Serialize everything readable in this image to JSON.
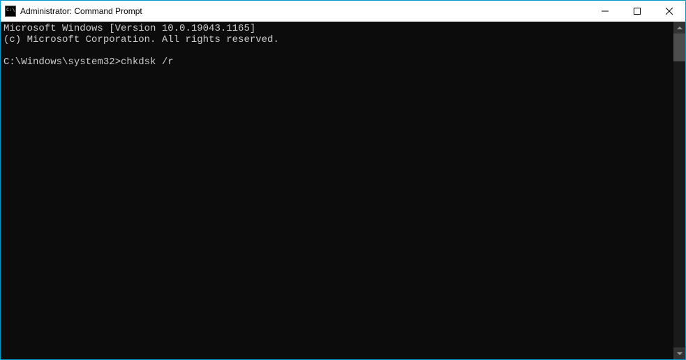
{
  "window": {
    "title": "Administrator: Command Prompt"
  },
  "terminal": {
    "line1": "Microsoft Windows [Version 10.0.19043.1165]",
    "line2": "(c) Microsoft Corporation. All rights reserved.",
    "blank": "",
    "prompt": "C:\\Windows\\system32>",
    "command": "chkdsk /r"
  }
}
